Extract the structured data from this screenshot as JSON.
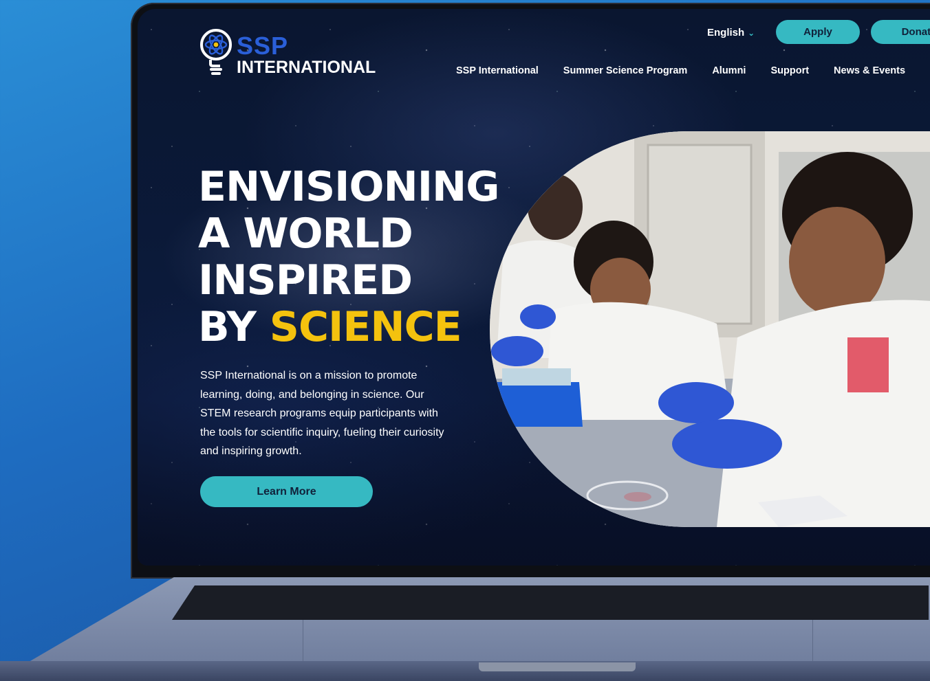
{
  "header": {
    "logo_top": "SSP",
    "logo_bottom": "INTERNATIONAL",
    "language": "English",
    "apply_label": "Apply",
    "donate_label": "Donate"
  },
  "nav": {
    "items": [
      "SSP International",
      "Summer Science Program",
      "Alumni",
      "Support",
      "News & Events"
    ]
  },
  "hero": {
    "line1": "ENVISIONING",
    "line2": "A WORLD",
    "line3": "INSPIRED",
    "line4_prefix": "BY ",
    "line4_accent": "SCIENCE",
    "description": "SSP International is on a mission to promote learning, doing, and belonging in science. Our STEM research programs equip participants with the tools for scientific inquiry, fueling their curiosity and inspiring growth.",
    "cta_label": "Learn More"
  },
  "colors": {
    "accent_teal": "#36b9c2",
    "accent_yellow": "#f4c20e",
    "logo_blue": "#2a5fd8"
  }
}
